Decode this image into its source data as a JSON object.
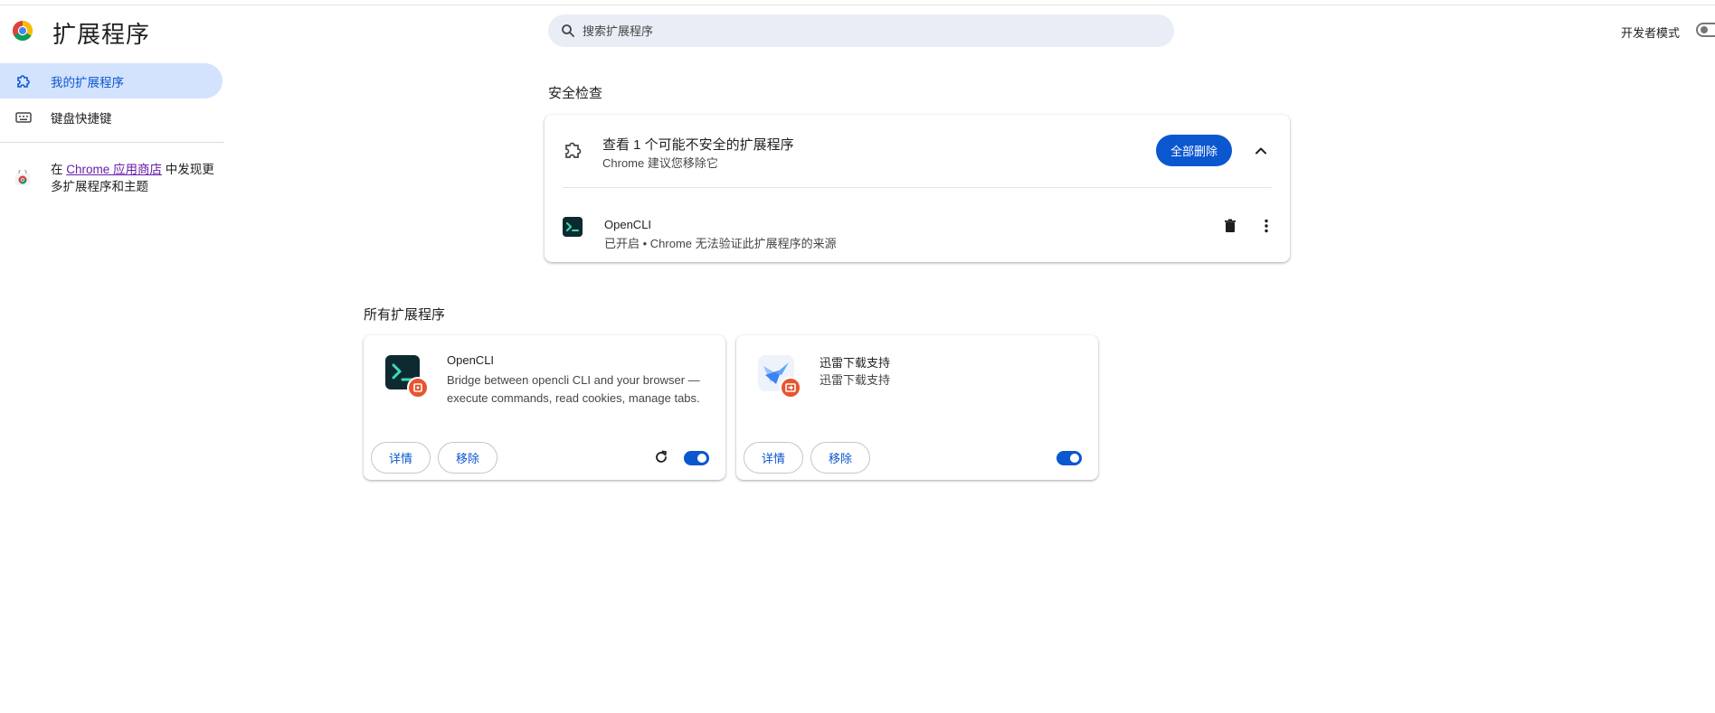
{
  "header": {
    "title": "扩展程序",
    "search_placeholder": "搜索扩展程序",
    "dev_mode_label": "开发者模式"
  },
  "sidebar": {
    "items": [
      {
        "label": "我的扩展程序",
        "icon": "extension-puzzle-icon",
        "active": true
      },
      {
        "label": "键盘快捷键",
        "icon": "keyboard-icon",
        "active": false
      }
    ],
    "store": {
      "prefix": "在 ",
      "link": "Chrome 应用商店",
      "suffix": " 中发现更多扩展程序和主题"
    }
  },
  "safety_check": {
    "section_title": "安全检查",
    "title": "查看 1 个可能不安全的扩展程序",
    "subtitle": "Chrome 建议您移除它",
    "remove_all_label": "全部删除",
    "item": {
      "name": "OpenCLI",
      "status": "已开启 • Chrome 无法验证此扩展程序的来源"
    }
  },
  "all_extensions": {
    "section_title": "所有扩展程序",
    "cards": [
      {
        "name": "OpenCLI",
        "description": "Bridge between opencli CLI and your browser — execute commands, read cookies, manage tabs.",
        "details_label": "详情",
        "remove_label": "移除",
        "enabled": true,
        "has_reload": true
      },
      {
        "name": "迅雷下载支持",
        "description": "迅雷下载支持",
        "details_label": "详情",
        "remove_label": "移除",
        "enabled": true,
        "has_reload": false
      }
    ]
  },
  "colors": {
    "accent": "#0b57d0",
    "active_bg": "#d3e3fd",
    "badge": "#e8542f"
  }
}
